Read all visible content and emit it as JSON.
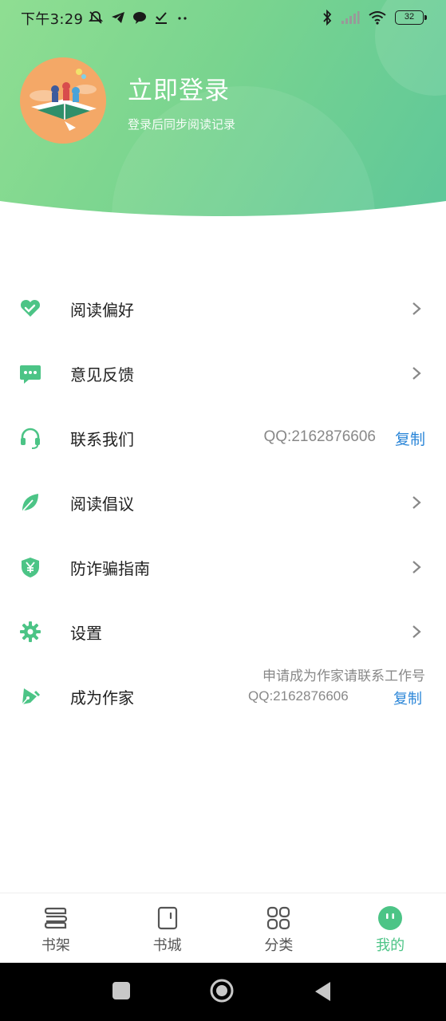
{
  "status_bar": {
    "time": "下午3:29",
    "battery": "32"
  },
  "profile": {
    "title": "立即登录",
    "subtitle": "登录后同步阅读记录"
  },
  "menu": {
    "items": [
      {
        "label": "阅读偏好",
        "icon": "heart-icon"
      },
      {
        "label": "意见反馈",
        "icon": "chat-bubble-icon"
      },
      {
        "label": "联系我们",
        "icon": "headset-icon",
        "right_text": "QQ:2162876606",
        "action": "复制"
      },
      {
        "label": "阅读倡议",
        "icon": "leaf-icon"
      },
      {
        "label": "防诈骗指南",
        "icon": "shield-yen-icon"
      },
      {
        "label": "设置",
        "icon": "gear-icon"
      },
      {
        "label": "成为作家",
        "icon": "pen-icon",
        "note_line1": "申请成为作家请联系工作号",
        "note_line2": "QQ:2162876606",
        "action": "复制"
      }
    ]
  },
  "bottom_nav": {
    "items": [
      {
        "label": "书架",
        "icon": "bookshelf-icon"
      },
      {
        "label": "书城",
        "icon": "bookstore-icon"
      },
      {
        "label": "分类",
        "icon": "grid-icon"
      },
      {
        "label": "我的",
        "icon": "profile-face-icon",
        "active": true
      }
    ]
  },
  "colors": {
    "accent_green": "#4cc486",
    "link_blue": "#2b86d8",
    "header_gradient_start": "#8fde92",
    "header_gradient_end": "#5ec79a"
  }
}
